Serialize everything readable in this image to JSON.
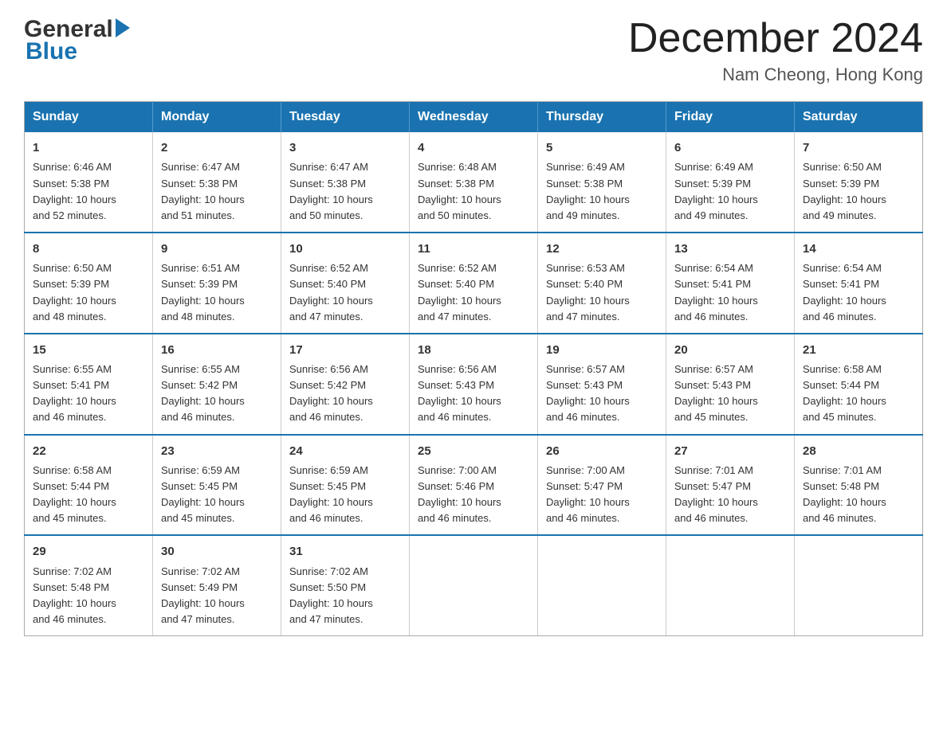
{
  "header": {
    "logo_general": "General",
    "logo_blue": "Blue",
    "month_title": "December 2024",
    "location": "Nam Cheong, Hong Kong"
  },
  "weekdays": [
    "Sunday",
    "Monday",
    "Tuesday",
    "Wednesday",
    "Thursday",
    "Friday",
    "Saturday"
  ],
  "weeks": [
    [
      {
        "day": "1",
        "sunrise": "6:46 AM",
        "sunset": "5:38 PM",
        "daylight": "10 hours and 52 minutes."
      },
      {
        "day": "2",
        "sunrise": "6:47 AM",
        "sunset": "5:38 PM",
        "daylight": "10 hours and 51 minutes."
      },
      {
        "day": "3",
        "sunrise": "6:47 AM",
        "sunset": "5:38 PM",
        "daylight": "10 hours and 50 minutes."
      },
      {
        "day": "4",
        "sunrise": "6:48 AM",
        "sunset": "5:38 PM",
        "daylight": "10 hours and 50 minutes."
      },
      {
        "day": "5",
        "sunrise": "6:49 AM",
        "sunset": "5:38 PM",
        "daylight": "10 hours and 49 minutes."
      },
      {
        "day": "6",
        "sunrise": "6:49 AM",
        "sunset": "5:39 PM",
        "daylight": "10 hours and 49 minutes."
      },
      {
        "day": "7",
        "sunrise": "6:50 AM",
        "sunset": "5:39 PM",
        "daylight": "10 hours and 49 minutes."
      }
    ],
    [
      {
        "day": "8",
        "sunrise": "6:50 AM",
        "sunset": "5:39 PM",
        "daylight": "10 hours and 48 minutes."
      },
      {
        "day": "9",
        "sunrise": "6:51 AM",
        "sunset": "5:39 PM",
        "daylight": "10 hours and 48 minutes."
      },
      {
        "day": "10",
        "sunrise": "6:52 AM",
        "sunset": "5:40 PM",
        "daylight": "10 hours and 47 minutes."
      },
      {
        "day": "11",
        "sunrise": "6:52 AM",
        "sunset": "5:40 PM",
        "daylight": "10 hours and 47 minutes."
      },
      {
        "day": "12",
        "sunrise": "6:53 AM",
        "sunset": "5:40 PM",
        "daylight": "10 hours and 47 minutes."
      },
      {
        "day": "13",
        "sunrise": "6:54 AM",
        "sunset": "5:41 PM",
        "daylight": "10 hours and 46 minutes."
      },
      {
        "day": "14",
        "sunrise": "6:54 AM",
        "sunset": "5:41 PM",
        "daylight": "10 hours and 46 minutes."
      }
    ],
    [
      {
        "day": "15",
        "sunrise": "6:55 AM",
        "sunset": "5:41 PM",
        "daylight": "10 hours and 46 minutes."
      },
      {
        "day": "16",
        "sunrise": "6:55 AM",
        "sunset": "5:42 PM",
        "daylight": "10 hours and 46 minutes."
      },
      {
        "day": "17",
        "sunrise": "6:56 AM",
        "sunset": "5:42 PM",
        "daylight": "10 hours and 46 minutes."
      },
      {
        "day": "18",
        "sunrise": "6:56 AM",
        "sunset": "5:43 PM",
        "daylight": "10 hours and 46 minutes."
      },
      {
        "day": "19",
        "sunrise": "6:57 AM",
        "sunset": "5:43 PM",
        "daylight": "10 hours and 46 minutes."
      },
      {
        "day": "20",
        "sunrise": "6:57 AM",
        "sunset": "5:43 PM",
        "daylight": "10 hours and 45 minutes."
      },
      {
        "day": "21",
        "sunrise": "6:58 AM",
        "sunset": "5:44 PM",
        "daylight": "10 hours and 45 minutes."
      }
    ],
    [
      {
        "day": "22",
        "sunrise": "6:58 AM",
        "sunset": "5:44 PM",
        "daylight": "10 hours and 45 minutes."
      },
      {
        "day": "23",
        "sunrise": "6:59 AM",
        "sunset": "5:45 PM",
        "daylight": "10 hours and 45 minutes."
      },
      {
        "day": "24",
        "sunrise": "6:59 AM",
        "sunset": "5:45 PM",
        "daylight": "10 hours and 46 minutes."
      },
      {
        "day": "25",
        "sunrise": "7:00 AM",
        "sunset": "5:46 PM",
        "daylight": "10 hours and 46 minutes."
      },
      {
        "day": "26",
        "sunrise": "7:00 AM",
        "sunset": "5:47 PM",
        "daylight": "10 hours and 46 minutes."
      },
      {
        "day": "27",
        "sunrise": "7:01 AM",
        "sunset": "5:47 PM",
        "daylight": "10 hours and 46 minutes."
      },
      {
        "day": "28",
        "sunrise": "7:01 AM",
        "sunset": "5:48 PM",
        "daylight": "10 hours and 46 minutes."
      }
    ],
    [
      {
        "day": "29",
        "sunrise": "7:02 AM",
        "sunset": "5:48 PM",
        "daylight": "10 hours and 46 minutes."
      },
      {
        "day": "30",
        "sunrise": "7:02 AM",
        "sunset": "5:49 PM",
        "daylight": "10 hours and 47 minutes."
      },
      {
        "day": "31",
        "sunrise": "7:02 AM",
        "sunset": "5:50 PM",
        "daylight": "10 hours and 47 minutes."
      },
      null,
      null,
      null,
      null
    ]
  ],
  "labels": {
    "sunrise": "Sunrise:",
    "sunset": "Sunset:",
    "daylight": "Daylight:"
  }
}
